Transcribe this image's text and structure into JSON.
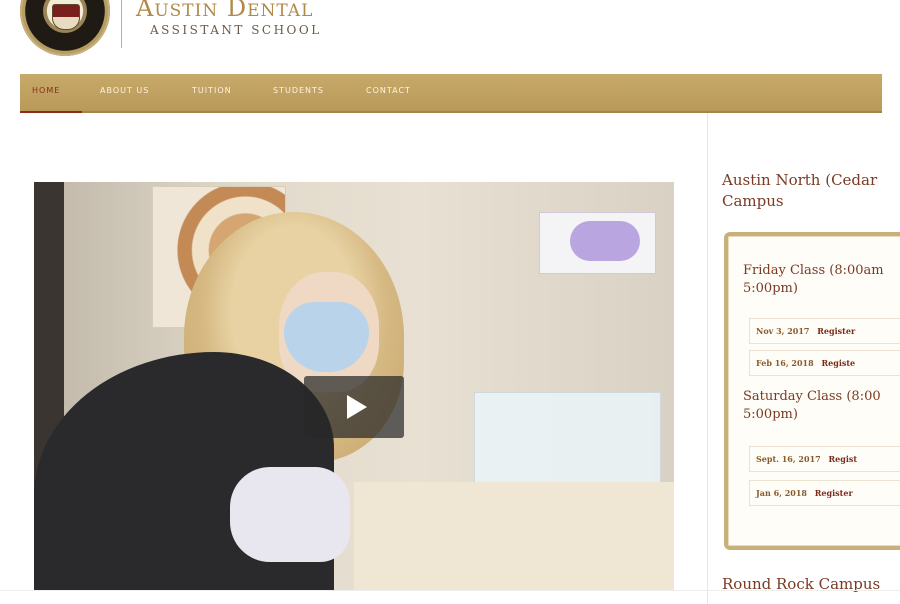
{
  "brand": {
    "title": "Austin Dental",
    "subtitle": "ASSISTANT SCHOOL"
  },
  "nav": {
    "items": [
      {
        "label": "HOME",
        "active": true
      },
      {
        "label": "ABOUT US",
        "active": false
      },
      {
        "label": "TUITION",
        "active": false
      },
      {
        "label": "STUDENTS",
        "active": false
      },
      {
        "label": "CONTACT",
        "active": false
      }
    ]
  },
  "video": {
    "play_icon": "play-icon"
  },
  "sidebar": {
    "heading": "Austin North (Cedar Campus",
    "classes": [
      {
        "title": "Friday Class (8:00am 5:00pm)",
        "dates": [
          {
            "date": "Nov 3, 2017",
            "action": "Register"
          },
          {
            "date": "Feb 16, 2018",
            "action": "Registe"
          }
        ]
      },
      {
        "title": "Saturday Class (8:00 5:00pm)",
        "dates": [
          {
            "date": "Sept. 16, 2017",
            "action": "Regist"
          },
          {
            "date": "Jan 6, 2018",
            "action": "Register"
          }
        ]
      }
    ],
    "next_heading": "Round Rock Campus"
  },
  "colors": {
    "gold": "#c7a96a",
    "maroon": "#7a3a24",
    "nav_text": "#fff3dc"
  }
}
